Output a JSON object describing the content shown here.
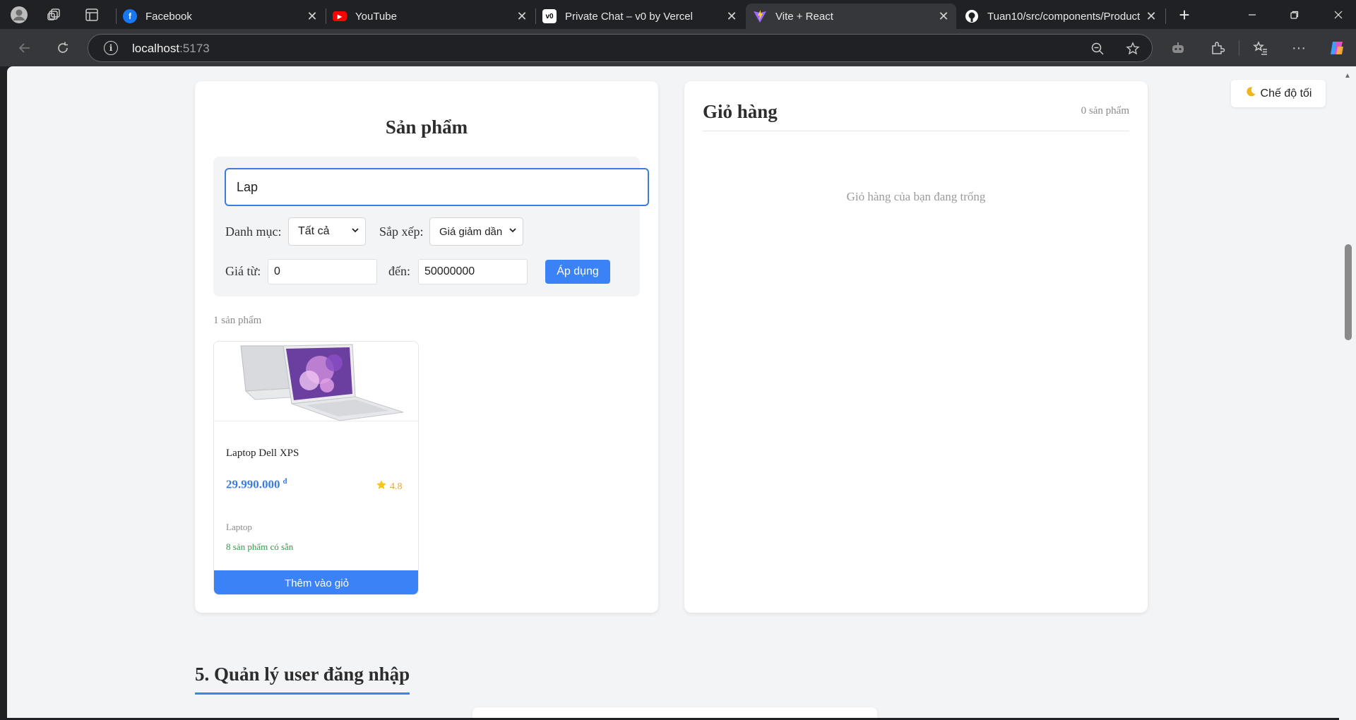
{
  "browser": {
    "tabs": [
      {
        "title": "Facebook",
        "icon": "facebook-icon"
      },
      {
        "title": "YouTube",
        "icon": "youtube-icon"
      },
      {
        "title": "Private Chat – v0 by Vercel",
        "icon": "v0-icon"
      },
      {
        "title": "Vite + React",
        "icon": "vite-icon",
        "active": true
      },
      {
        "title": "Tuan10/src/components/Product",
        "icon": "github-icon"
      }
    ],
    "url_host": "localhost",
    "url_port": ":5173"
  },
  "products": {
    "title": "Sản phẩm",
    "search_value": "Lap",
    "category_label": "Danh mục:",
    "category_selected": "Tất cả",
    "sort_label": "Sắp xếp:",
    "sort_selected": "Giá giảm dần",
    "price_from_label": "Giá từ:",
    "price_from_value": "0",
    "price_to_label": "đến:",
    "price_to_value": "50000000",
    "apply_label": "Áp dụng",
    "count_text": "1 sản phẩm",
    "items": [
      {
        "name": "Laptop Dell XPS",
        "price": "29.990.000",
        "currency": "đ",
        "rating": "4.8",
        "category": "Laptop",
        "stock": "8 sản phẩm có sẵn",
        "button": "Thêm vào giỏ"
      }
    ]
  },
  "cart": {
    "title": "Giỏ hàng",
    "count": "0 sản phẩm",
    "empty_text": "Giỏ hàng của bạn đang trống"
  },
  "dark_mode": {
    "label": "Chế độ tối",
    "icon": "moon-icon"
  },
  "section": {
    "title": "5. Quản lý user đăng nhập"
  },
  "colors": {
    "accent": "#3b82f6",
    "stock_green": "#22a34a",
    "rating": "#e8a33a"
  }
}
